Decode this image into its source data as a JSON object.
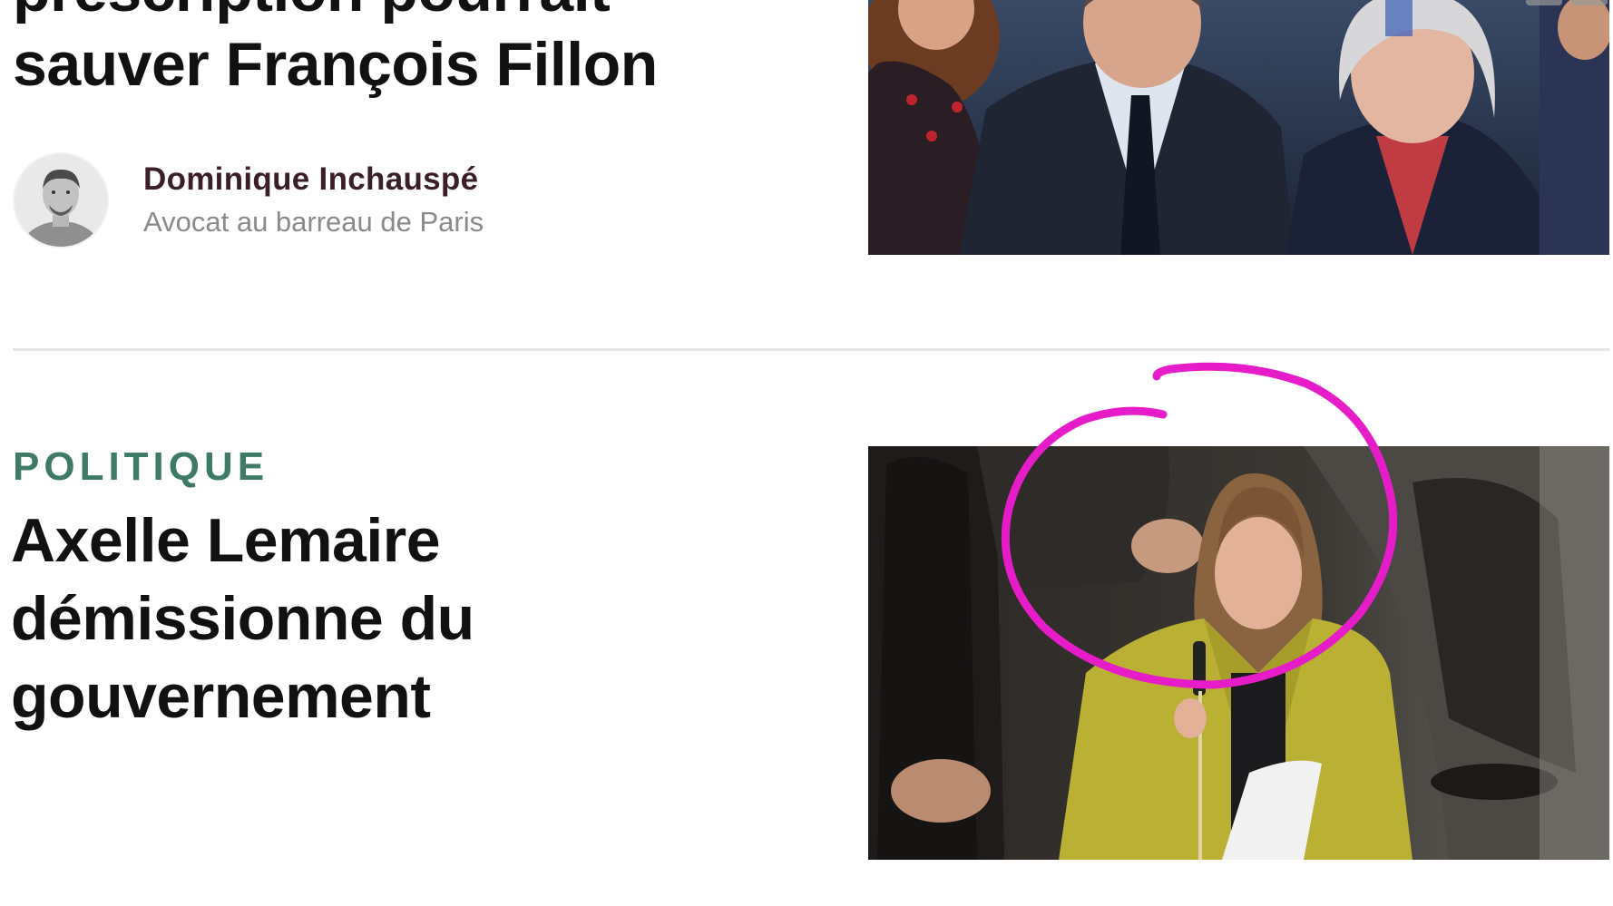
{
  "articles": [
    {
      "title_lines": [
        "prescription pourrait",
        "sauver François Fillon"
      ],
      "author": {
        "name": "Dominique Inchauspé",
        "role": "Avocat au barreau de Paris"
      },
      "image_icon": "photo-icon"
    },
    {
      "category": "POLITIQUE",
      "title_lines": [
        "Axelle Lemaire",
        "démissionne du",
        "gouvernement"
      ],
      "image_icon": "photo-icon"
    }
  ],
  "colors": {
    "category": "#3f7a66",
    "annotation": "#e61cc8",
    "separator": "#e5e5e5",
    "author_name": "#3a1f2a",
    "author_role": "#8a8a8a"
  },
  "icons": {
    "avatar": "avatar-photo",
    "annotation": "freehand-circle-annotation"
  }
}
